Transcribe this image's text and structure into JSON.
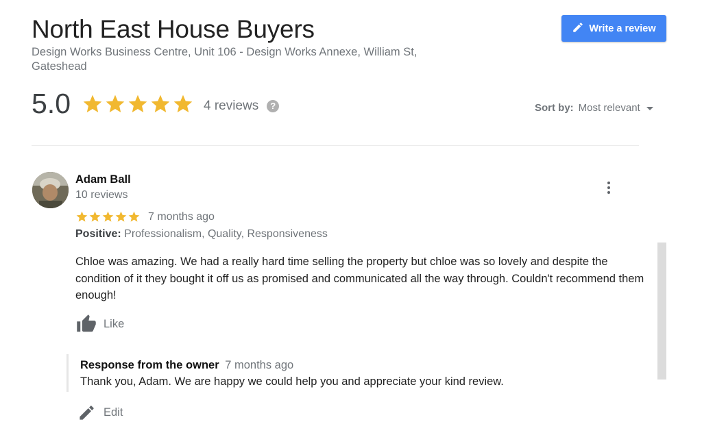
{
  "business": {
    "name": "North East House Buyers",
    "address": "Design Works Business Centre, Unit 106 - Design Works Annexe, William St, Gateshead"
  },
  "write_review": {
    "label": "Write a review",
    "icon": "pencil-icon"
  },
  "summary": {
    "rating": "5.0",
    "stars": 5,
    "reviews_count": "4 reviews",
    "help_icon": "?"
  },
  "sort": {
    "label": "Sort by:",
    "value": "Most relevant"
  },
  "colors": {
    "accent": "#4285f4",
    "star": "#f1b830",
    "muted": "#70757a"
  },
  "review": {
    "author": "Adam Ball",
    "author_reviews": "10 reviews",
    "stars": 5,
    "time": "7 months ago",
    "positive_label": "Positive:",
    "positive_values": "Professionalism, Quality, Responsiveness",
    "text": "Chloe was amazing. We had a really hard time selling the property but chloe was so lovely and despite the condition of it they bought it off us as promised and communicated all the way through. Couldn't recommend them enough!",
    "like_label": "Like"
  },
  "owner_response": {
    "label": "Response from the owner",
    "time": "7 months ago",
    "text": "Thank you, Adam. We are happy we could help you and appreciate your kind review."
  },
  "edit": {
    "label": "Edit"
  }
}
